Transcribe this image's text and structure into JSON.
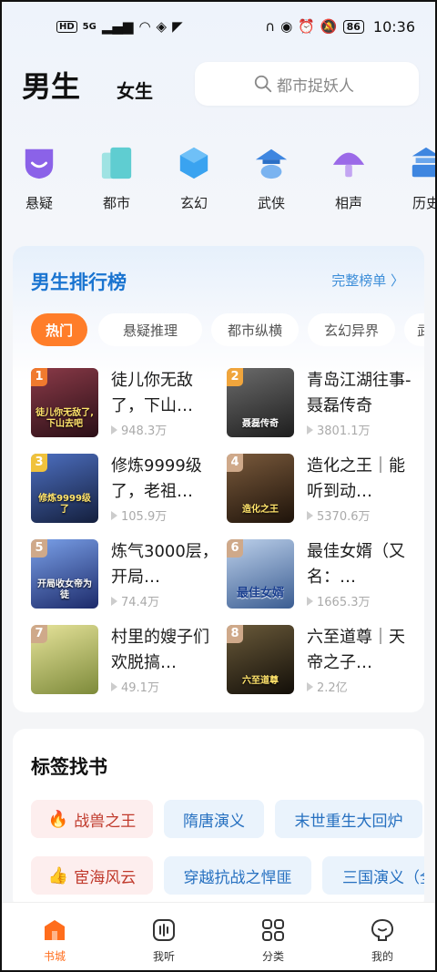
{
  "status_bar": {
    "left_chips": [
      "HD",
      "5G"
    ],
    "battery": "86",
    "time": "10:36"
  },
  "header": {
    "tab_male": "男生",
    "tab_female": "女生",
    "search_placeholder": "都市捉妖人"
  },
  "categories": [
    {
      "label": "悬疑",
      "icon": "suspense-icon",
      "color": "#8b62e8"
    },
    {
      "label": "都市",
      "icon": "city-icon",
      "color": "#5fcdd1"
    },
    {
      "label": "玄幻",
      "icon": "fantasy-icon",
      "color": "#3aa3f0"
    },
    {
      "label": "武侠",
      "icon": "wuxia-icon",
      "color": "#3e86e0"
    },
    {
      "label": "相声",
      "icon": "crosstalk-icon",
      "color": "#9b6ae8"
    },
    {
      "label": "历史",
      "icon": "history-icon",
      "color": "#3e86e0"
    }
  ],
  "ranking": {
    "title": "男生排行榜",
    "more": "完整榜单 〉",
    "pills": [
      "热门",
      "悬疑推理",
      "都市纵横",
      "玄幻异界",
      "武侠"
    ],
    "books": [
      {
        "rank": "1",
        "title": "徒儿你无敌了，下山…",
        "plays": "948.3万",
        "cover_text": "徒儿你无敌了,下山去吧",
        "cover_bg": "#5a2230",
        "rank_color": "#f07a2e"
      },
      {
        "rank": "2",
        "title": "青岛江湖往事-聂磊传奇",
        "plays": "3801.1万",
        "cover_text": "聂磊传奇",
        "cover_bg": "#3a3a3a",
        "rank_color": "#f0a53c"
      },
      {
        "rank": "3",
        "title": "修炼9999级了，老祖…",
        "plays": "105.9万",
        "cover_text": "修炼9999级了",
        "cover_bg": "#2a3a66",
        "rank_color": "#f0c23c"
      },
      {
        "rank": "4",
        "title": "造化之王｜能听到动…",
        "plays": "5370.6万",
        "cover_text": "造化之王",
        "cover_bg": "#3a2a1e",
        "rank_color": "#cfa98a"
      },
      {
        "rank": "5",
        "title": "炼气3000层，开局…",
        "plays": "74.4万",
        "cover_text": "开局收女帝为徒",
        "cover_bg": "#2c3f8a",
        "rank_color": "#cfa98a"
      },
      {
        "rank": "6",
        "title": "最佳女婿（又名：…",
        "plays": "1665.3万",
        "cover_text": "最佳女婿",
        "cover_bg": "#6d8fc0",
        "rank_color": "#cfa98a"
      },
      {
        "rank": "7",
        "title": "村里的嫂子们欢脱搞…",
        "plays": "49.1万",
        "cover_text": "",
        "cover_bg": "#c9c46a",
        "rank_color": "#cfa98a"
      },
      {
        "rank": "8",
        "title": "六至道尊｜天帝之子…",
        "plays": "2.2亿",
        "cover_text": "六至道尊",
        "cover_bg": "#2a2418",
        "rank_color": "#cfa98a"
      }
    ]
  },
  "tags": {
    "title": "标签找书",
    "items": [
      {
        "label": "战兽之王",
        "emoji": "🔥",
        "style": "hot"
      },
      {
        "label": "隋唐演义",
        "emoji": "",
        "style": "blue"
      },
      {
        "label": "末世重生大回炉",
        "emoji": "",
        "style": "blue"
      },
      {
        "label": "宦海风云",
        "emoji": "👍",
        "style": "hot"
      },
      {
        "label": "穿越抗战之悍匪",
        "emoji": "",
        "style": "blue"
      },
      {
        "label": "三国演义（全",
        "emoji": "",
        "style": "blue"
      }
    ]
  },
  "bottom_nav": [
    {
      "label": "书城",
      "active": true
    },
    {
      "label": "我听",
      "active": false
    },
    {
      "label": "分类",
      "active": false
    },
    {
      "label": "我的",
      "active": false
    }
  ],
  "colors": {
    "accent": "#ff7d29",
    "rank_title": "#1a74d0",
    "nav_active": "#ff6d1c"
  }
}
